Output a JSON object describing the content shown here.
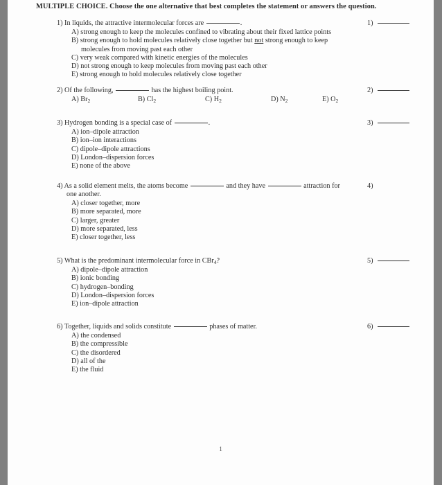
{
  "document": {
    "heading": "MULTIPLE CHOICE.  Choose the one alternative that best completes the statement or answers the question.",
    "page_number": "1"
  },
  "questions": [
    {
      "number": "1)",
      "answer_label": "1)",
      "has_answer_line": true,
      "stem_before_blank": "In liquids, the attractive intermolecular forces are ",
      "stem_after_blank": ".",
      "continuation": "",
      "layout": "stacked",
      "options": [
        {
          "letter": "A)",
          "text": "strong enough to keep the molecules confined to vibrating about their fixed lattice points",
          "wrap": ""
        },
        {
          "letter": "B)",
          "text": "strong enough to hold molecules relatively close together but ",
          "emphasis": "not",
          "text_after": " strong enough to keep",
          "wrap": "molecules from moving past each other"
        },
        {
          "letter": "C)",
          "text": "very weak compared with kinetic energies of the molecules",
          "wrap": ""
        },
        {
          "letter": "D)",
          "text": "not strong enough to keep molecules from moving past each other",
          "wrap": ""
        },
        {
          "letter": "E)",
          "text": "strong enough to hold molecules relatively close together",
          "wrap": ""
        }
      ]
    },
    {
      "number": "2)",
      "answer_label": "2)",
      "has_answer_line": true,
      "stem_before_blank": "Of the following, ",
      "stem_after_blank": " has the highest boiling point.",
      "continuation": "",
      "layout": "inline",
      "options": [
        {
          "letter": "A)",
          "formula_base": "Br",
          "formula_sub": "2"
        },
        {
          "letter": "B)",
          "formula_base": "Cl",
          "formula_sub": "2"
        },
        {
          "letter": "C)",
          "formula_base": "H",
          "formula_sub": "2"
        },
        {
          "letter": "D)",
          "formula_base": "N",
          "formula_sub": "2"
        },
        {
          "letter": "E)",
          "formula_base": "O",
          "formula_sub": "2"
        }
      ]
    },
    {
      "number": "3)",
      "answer_label": "3)",
      "has_answer_line": true,
      "stem_before_blank": "Hydrogen bonding is a special case of ",
      "stem_after_blank": ".",
      "continuation": "",
      "layout": "stacked",
      "options": [
        {
          "letter": "A)",
          "text": "ion–dipole attraction",
          "wrap": ""
        },
        {
          "letter": "B)",
          "text": "ion–ion interactions",
          "wrap": ""
        },
        {
          "letter": "C)",
          "text": "dipole–dipole attractions",
          "wrap": ""
        },
        {
          "letter": "D)",
          "text": "London–dispersion forces",
          "wrap": ""
        },
        {
          "letter": "E)",
          "text": "none of the above",
          "wrap": ""
        }
      ]
    },
    {
      "number": "4)",
      "answer_label": "4)",
      "has_answer_line": false,
      "stem_before_blank": "As a solid element melts, the atoms become ",
      "stem_middle": " and they have ",
      "stem_after_blank": " attraction for",
      "continuation": "one another.",
      "layout": "stacked",
      "options": [
        {
          "letter": "A)",
          "text": "closer together, more",
          "wrap": ""
        },
        {
          "letter": "B)",
          "text": "more separated, more",
          "wrap": ""
        },
        {
          "letter": "C)",
          "text": "larger, greater",
          "wrap": ""
        },
        {
          "letter": "D)",
          "text": "more separated, less",
          "wrap": ""
        },
        {
          "letter": "E)",
          "text": "closer together, less",
          "wrap": ""
        }
      ]
    },
    {
      "number": "5)",
      "answer_label": "5)",
      "has_answer_line": true,
      "stem_before_blank": "What is the predominant intermolecular force in CBr",
      "stem_sub": "4",
      "stem_after_blank": "?",
      "continuation": "",
      "layout": "stacked",
      "options": [
        {
          "letter": "A)",
          "text": "dipole–dipole attraction",
          "wrap": ""
        },
        {
          "letter": "B)",
          "text": "ionic bonding",
          "wrap": ""
        },
        {
          "letter": "C)",
          "text": "hydrogen–bonding",
          "wrap": ""
        },
        {
          "letter": "D)",
          "text": "London–dispersion forces",
          "wrap": ""
        },
        {
          "letter": "E)",
          "text": "ion–dipole attraction",
          "wrap": ""
        }
      ]
    },
    {
      "number": "6)",
      "answer_label": "6)",
      "has_answer_line": true,
      "stem_before_blank": "Together, liquids and solids constitute ",
      "stem_after_blank": " phases of matter.",
      "continuation": "",
      "layout": "stacked",
      "options": [
        {
          "letter": "A)",
          "text": "the condensed",
          "wrap": ""
        },
        {
          "letter": "B)",
          "text": "the compressible",
          "wrap": ""
        },
        {
          "letter": "C)",
          "text": "the disordered",
          "wrap": ""
        },
        {
          "letter": "D)",
          "text": "all of the",
          "wrap": ""
        },
        {
          "letter": "E)",
          "text": "the fluid",
          "wrap": ""
        }
      ]
    }
  ]
}
